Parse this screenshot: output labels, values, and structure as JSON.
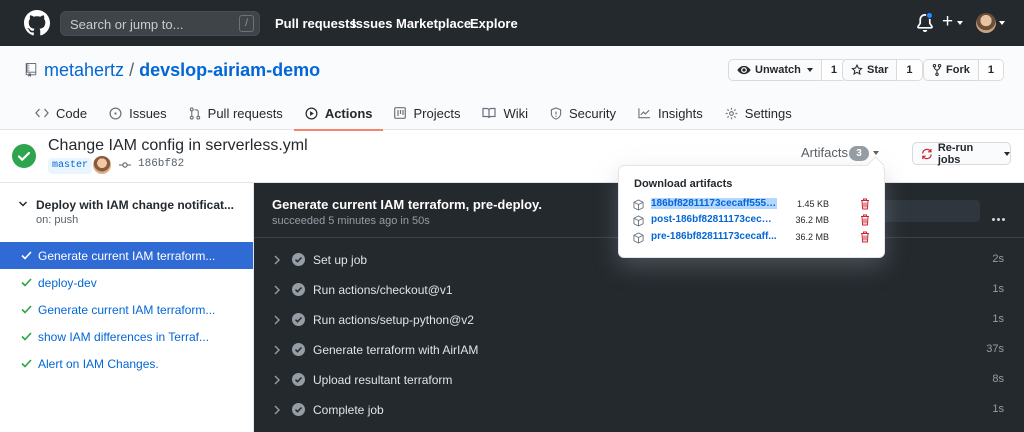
{
  "header": {
    "search_placeholder": "Search or jump to...",
    "search_shortcut": "/",
    "nav": [
      "Pull requests",
      "Issues",
      "Marketplace",
      "Explore"
    ],
    "plus_label": "+"
  },
  "repo": {
    "owner": "metahertz",
    "separator": "/",
    "name": "devslop-airiam-demo",
    "unwatch_label": "Unwatch",
    "unwatch_count": "1",
    "star_label": "Star",
    "star_count": "1",
    "fork_label": "Fork",
    "fork_count": "1"
  },
  "tabs": [
    {
      "label": "Code"
    },
    {
      "label": "Issues"
    },
    {
      "label": "Pull requests"
    },
    {
      "label": "Actions"
    },
    {
      "label": "Projects"
    },
    {
      "label": "Wiki"
    },
    {
      "label": "Security"
    },
    {
      "label": "Insights"
    },
    {
      "label": "Settings"
    }
  ],
  "run": {
    "title": "Change IAM config in serverless.yml",
    "branch": "master",
    "sha": "186bf82",
    "artifacts_label": "Artifacts",
    "artifacts_count": "3",
    "rerun_label": "Re-run jobs"
  },
  "sidebar": {
    "workflow_name": "Deploy with IAM change notificat...",
    "trigger": "on: push",
    "jobs": [
      {
        "label": "Generate current IAM terraform..."
      },
      {
        "label": "deploy-dev"
      },
      {
        "label": "Generate current IAM terraform..."
      },
      {
        "label": "show IAM differences in Terraf..."
      },
      {
        "label": "Alert on IAM Changes."
      }
    ]
  },
  "log": {
    "title": "Generate current IAM terraform, pre-deploy.",
    "subtitle": "succeeded 5 minutes ago in 50s",
    "steps": [
      {
        "name": "Set up job",
        "duration": "2s"
      },
      {
        "name": "Run actions/checkout@v1",
        "duration": "1s"
      },
      {
        "name": "Run actions/setup-python@v2",
        "duration": "1s"
      },
      {
        "name": "Generate terraform with AirIAM",
        "duration": "37s"
      },
      {
        "name": "Upload resultant terraform",
        "duration": "8s"
      },
      {
        "name": "Complete job",
        "duration": "1s"
      }
    ]
  },
  "artifacts": {
    "title": "Download artifacts",
    "items": [
      {
        "name": "186bf82811173cecaff555e...",
        "size": "1.45 KB"
      },
      {
        "name": "post-186bf82811173cecaf...",
        "size": "36.2 MB"
      },
      {
        "name": "pre-186bf82811173cecaff...",
        "size": "36.2 MB"
      }
    ]
  },
  "colors": {
    "header_bg": "#24292e",
    "link": "#0366d6",
    "success": "#2ea44f",
    "active_job": "#2f6ad5",
    "tab_underline": "#f9826c",
    "delete": "#cb2431"
  }
}
